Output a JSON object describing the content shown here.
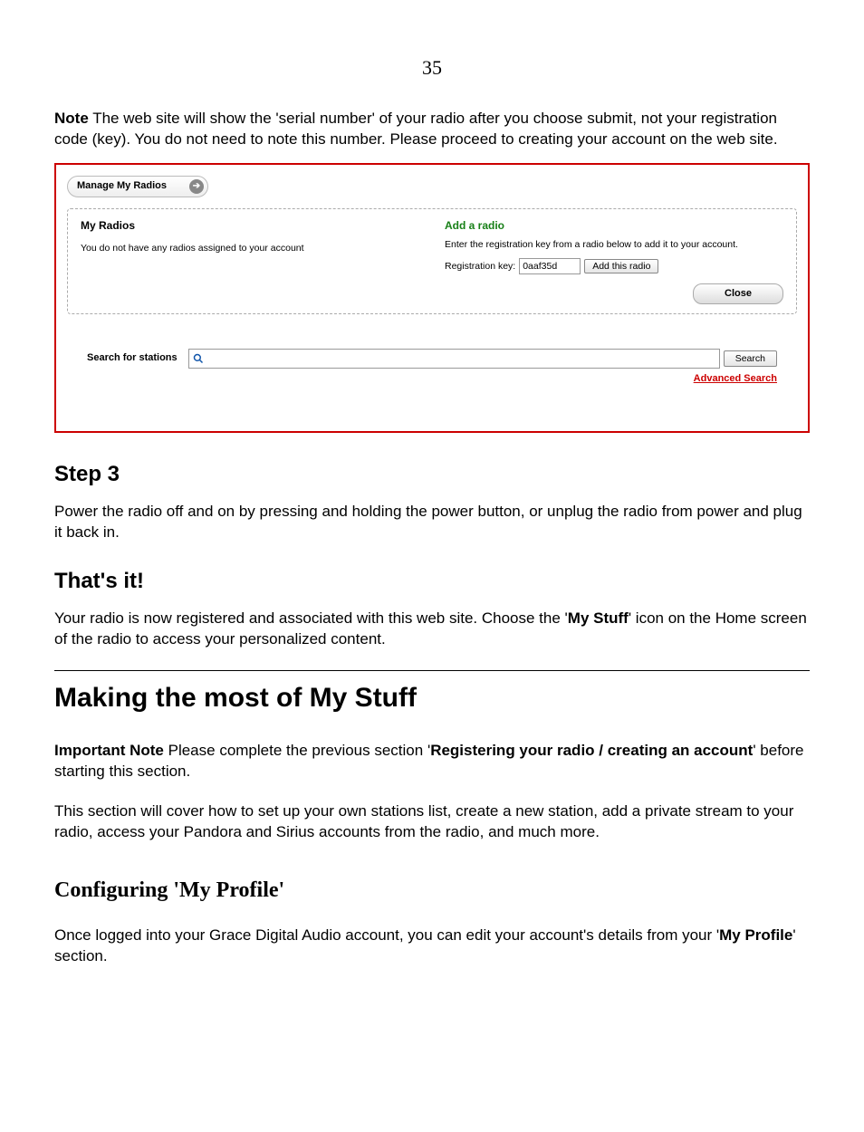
{
  "page_number": "35",
  "note": {
    "label": "Note",
    "body_a": "   The web site will show the 'serial number' of your radio after you choose submit, not your registration code (key).  You do not need to note this number.  Please proceed to creating your account on the web site."
  },
  "panel": {
    "manage_label": "Manage My Radios",
    "my_radios_title": "My Radios",
    "my_radios_msg": "You do not have any radios assigned to your account",
    "add_title": "Add a radio",
    "add_msg": "Enter the registration key from a radio below to add it to your account.",
    "reg_label": "Registration key:",
    "reg_value": "0aaf35d",
    "add_btn": "Add this radio",
    "close_btn": "Close",
    "search_label": "Search for stations",
    "search_btn": "Search",
    "advanced": "Advanced Search"
  },
  "step3": {
    "heading": "Step 3",
    "body": "Power the radio off and on by pressing and holding the power button, or unplug the radio from power and plug it back in."
  },
  "thats_it": {
    "heading": "That's it!",
    "body_a": "Your radio is now registered and associated with this web site.  Choose the '",
    "bold": "My Stuff",
    "body_b": "' icon on the Home screen of the radio to access your personalized content."
  },
  "making": {
    "heading": "Making the most of My Stuff",
    "imp_label": "Important Note",
    "imp_a": "   Please complete the previous section '",
    "imp_bold": "Registering your radio / creating an account",
    "imp_b": "' before starting this section.",
    "p2": "This section will cover how to set up your own stations list, create a new station, add a private stream to your radio, access your Pandora and Sirius accounts from the radio, and much more."
  },
  "config": {
    "heading": "Configuring 'My Profile'",
    "body_a": "Once logged into your Grace Digital Audio account, you can edit your account's details from your '",
    "bold": "My Profile",
    "body_b": "' section."
  }
}
